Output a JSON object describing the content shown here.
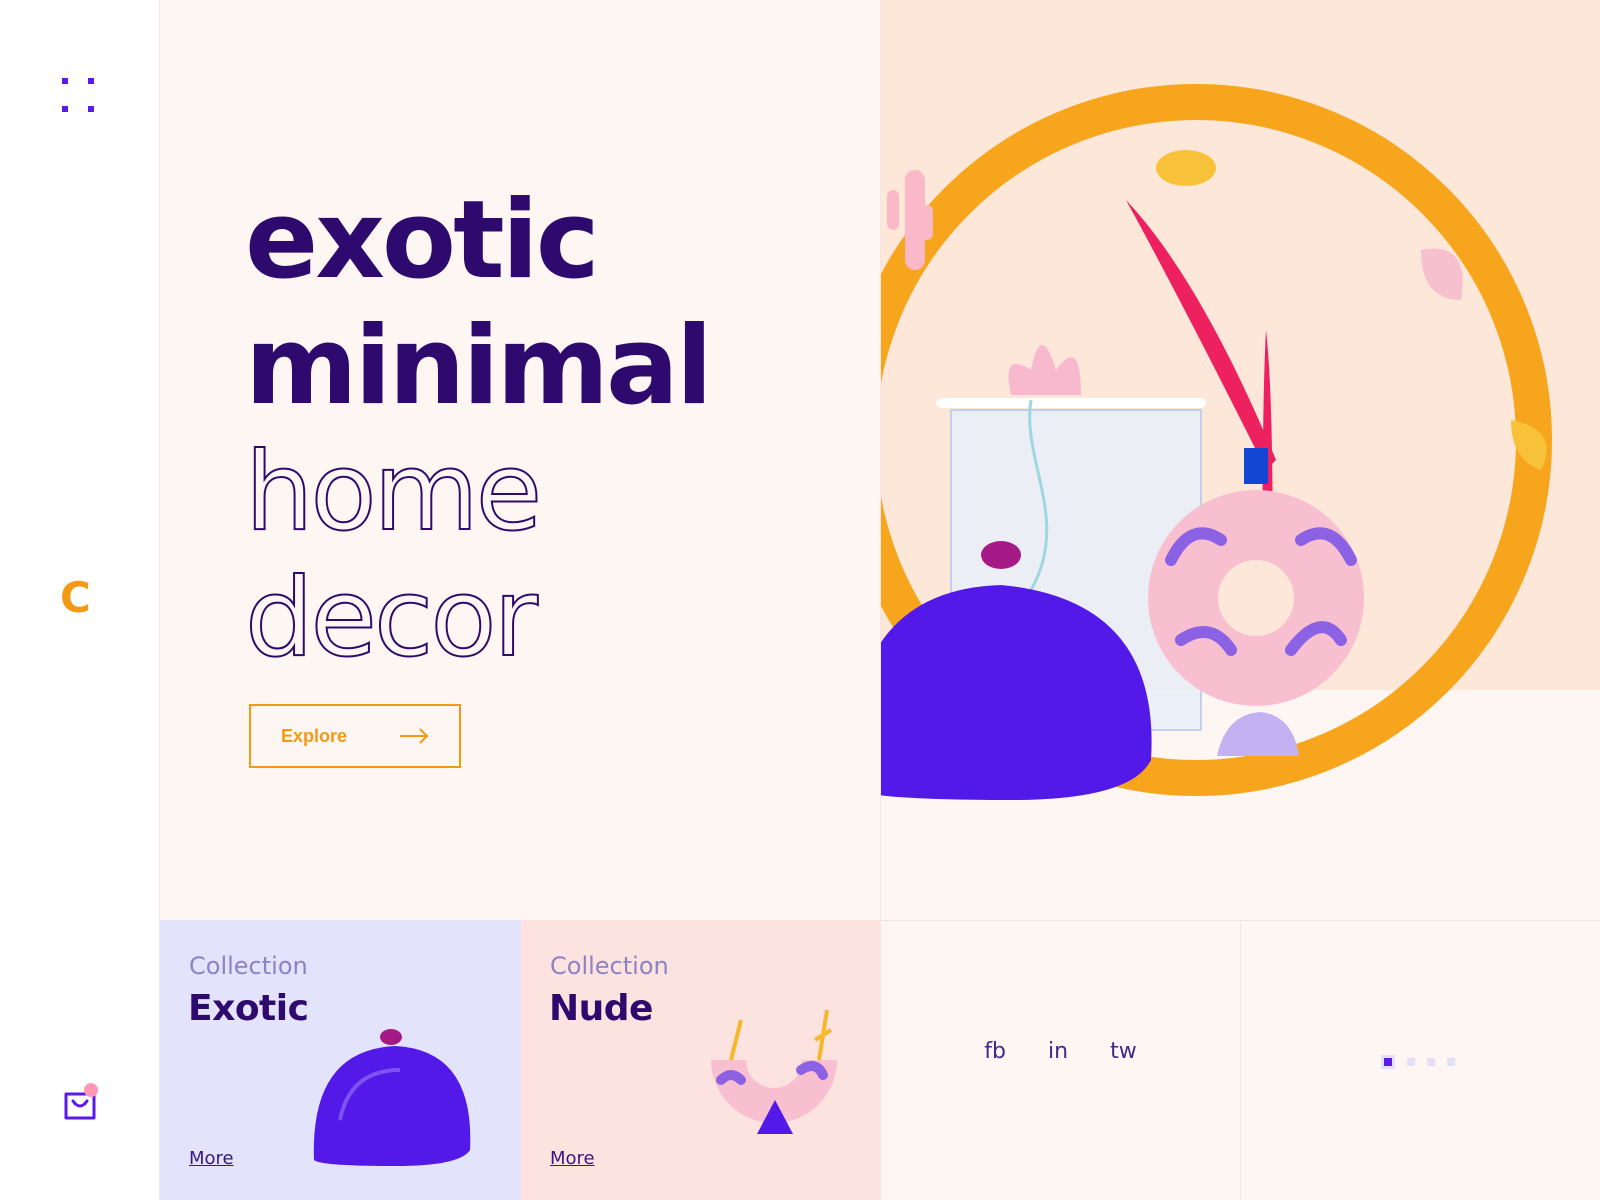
{
  "sidebar": {
    "menu_icon": "grid-dots-icon",
    "logo_letter": "C",
    "cart_icon": "shopping-bag-icon"
  },
  "hero": {
    "headline": {
      "line1": "exotic",
      "line2": "minimal",
      "line3": "home",
      "line4": "decor"
    },
    "cta_label": "Explore",
    "cta_icon": "arrow-right-icon"
  },
  "collections": [
    {
      "kicker": "Collection",
      "name": "Exotic",
      "more": "More"
    },
    {
      "kicker": "Collection",
      "name": "Nude",
      "more": "More"
    }
  ],
  "social": {
    "fb": "fb",
    "in": "in",
    "tw": "tw"
  },
  "pager": {
    "pages": 4,
    "active": 1
  },
  "colors": {
    "primary_purple": "#2e0a6e",
    "accent_violet": "#5b18f0",
    "accent_orange": "#f39a14",
    "bg_cream": "#fdf6f2",
    "bg_peach": "#fde7d9",
    "card_lavender": "#e3e3fc",
    "card_pink": "#fde3e0"
  }
}
